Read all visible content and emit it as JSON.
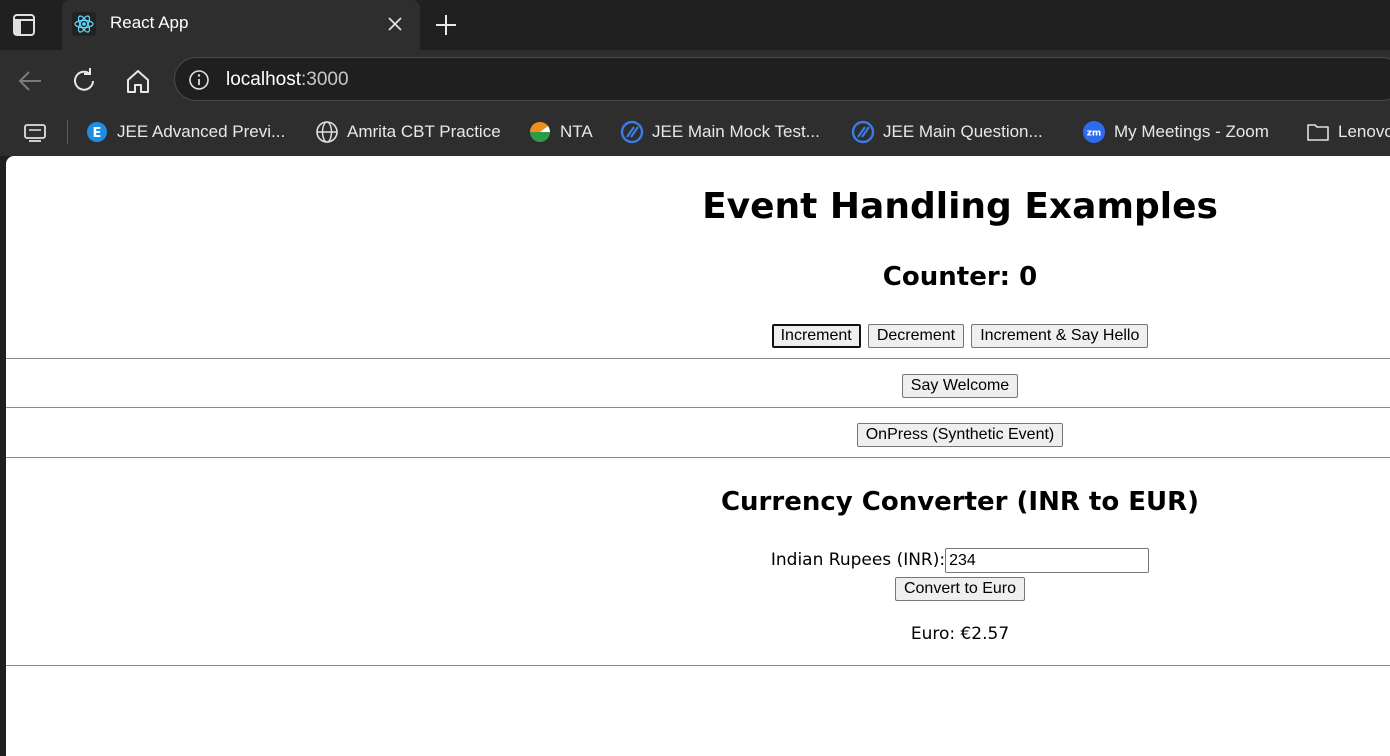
{
  "browser": {
    "tab_title": "React App",
    "url_host": "localhost",
    "url_port": ":3000",
    "bookmarks": [
      {
        "label": "JEE Advanced Previ...",
        "icon": "e-letter-icon"
      },
      {
        "label": "Amrita CBT Practice",
        "icon": "globe-icon"
      },
      {
        "label": "NTA",
        "icon": "nta-logo-icon"
      },
      {
        "label": "JEE Main Mock Test...",
        "icon": "slash-circle-icon"
      },
      {
        "label": "JEE Main Question...",
        "icon": "slash-circle-icon"
      },
      {
        "label": "My Meetings - Zoom",
        "icon": "zoom-icon"
      },
      {
        "label": "Lenovo",
        "icon": "folder-icon"
      }
    ]
  },
  "page": {
    "title": "Event Handling Examples",
    "counter_label": "Counter: 0",
    "buttons": {
      "increment": "Increment",
      "decrement": "Decrement",
      "increment_hello": "Increment & Say Hello",
      "say_welcome": "Say Welcome",
      "onpress": "OnPress (Synthetic Event)",
      "convert": "Convert to Euro"
    },
    "converter": {
      "heading": "Currency Converter (INR to EUR)",
      "input_label": "Indian Rupees (INR):",
      "input_value": "234",
      "result": "Euro: €2.57"
    }
  },
  "colors": {
    "chrome_dark": "#202020",
    "chrome_mid": "#2e2e2e",
    "page_bg": "#ffffff",
    "button_bg": "#efefef"
  }
}
